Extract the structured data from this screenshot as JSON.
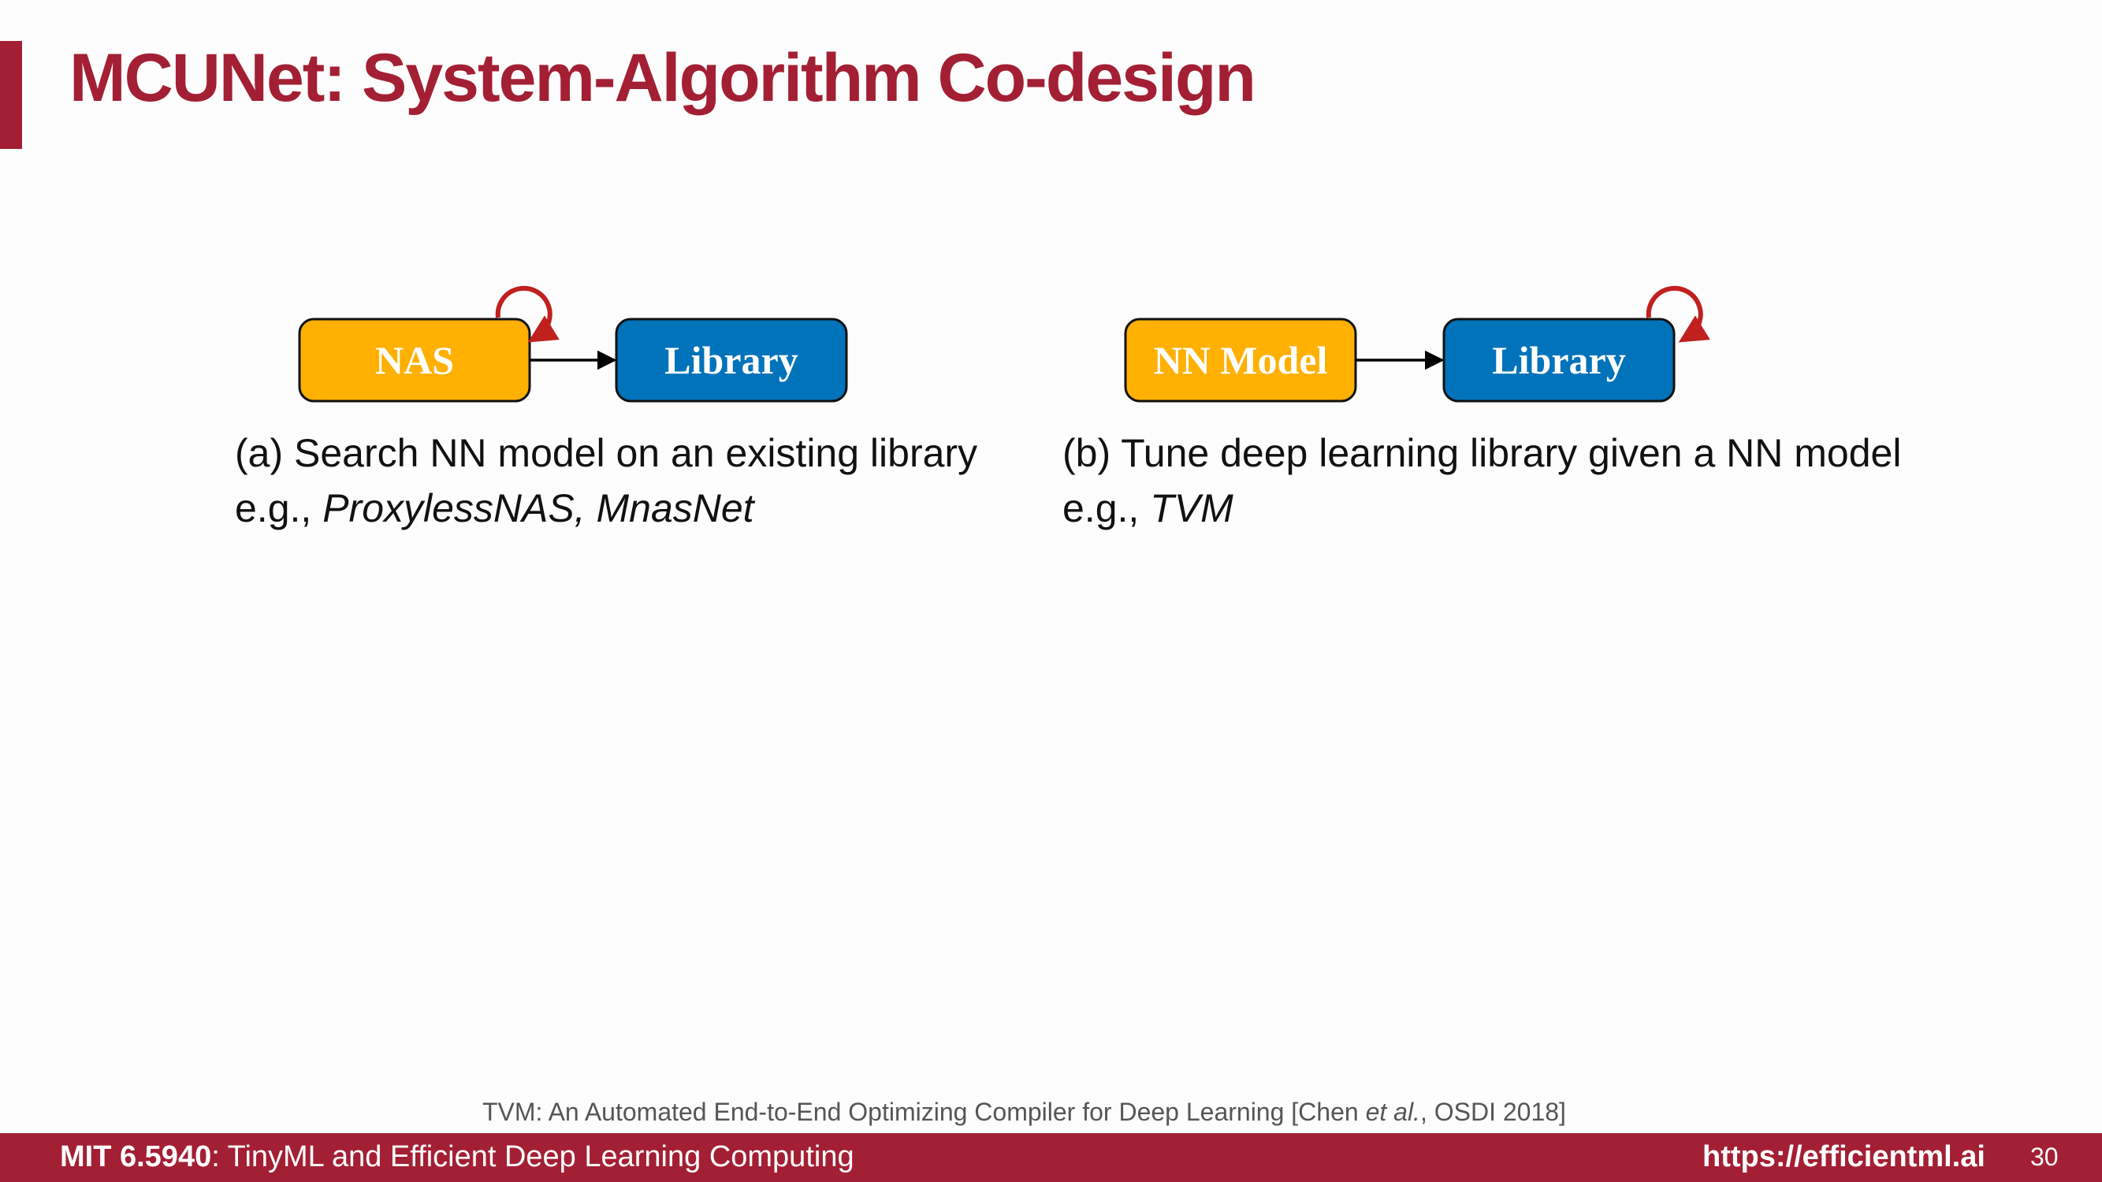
{
  "slide": {
    "title": "MCUNet: System-Algorithm Co-design"
  },
  "colors": {
    "accent": "#a31f34",
    "orange_box": "#ffb000",
    "blue_box": "#0073ba",
    "loop_arrow": "#c0201e"
  },
  "diagram_a": {
    "box_left": "NAS",
    "box_right": "Library",
    "loop_on": "left box",
    "caption": "(a) Search NN model on an existing library",
    "example_prefix": "e.g., ",
    "example_italic": "ProxylessNAS, MnasNet"
  },
  "diagram_b": {
    "box_left": "NN Model",
    "box_right": "Library",
    "loop_on": "right box",
    "caption": "(b) Tune deep learning library given a NN model",
    "example_prefix": "e.g., ",
    "example_italic": "TVM"
  },
  "reference": {
    "text_before": "TVM: An Automated End-to-End Optimizing Compiler for Deep Learning [Chen ",
    "italic": "et al.",
    "text_after": ", OSDI 2018]"
  },
  "footer": {
    "course_code": "MIT 6.5940",
    "course_name": ": TinyML and Efficient Deep Learning Computing",
    "url": "https://efficientml.ai",
    "page_number": "30"
  }
}
